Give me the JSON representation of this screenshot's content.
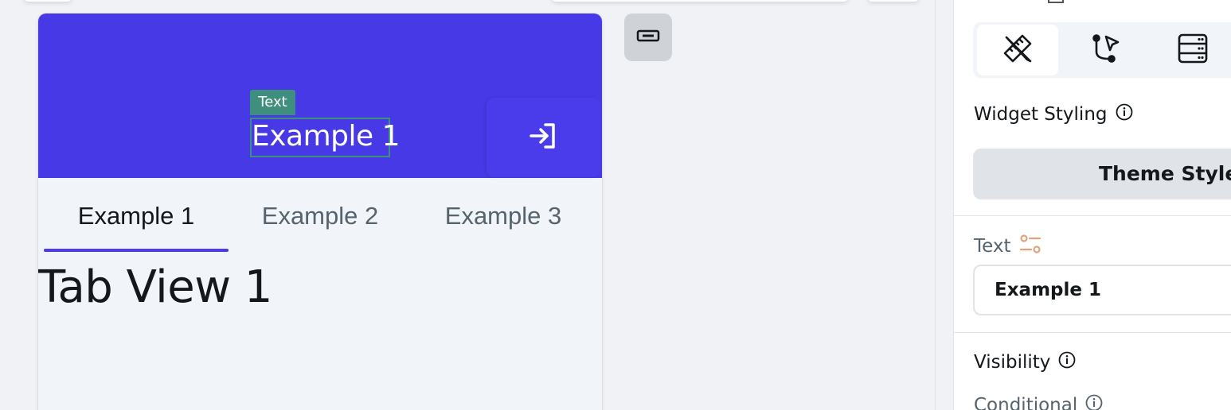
{
  "preview": {
    "selection_tag": "Text",
    "appbar_title": "Example 1",
    "tabs": [
      {
        "label": "Example 1",
        "active": true
      },
      {
        "label": "Example 2",
        "active": false
      },
      {
        "label": "Example 3",
        "active": false
      }
    ],
    "tab_content": "Tab View 1"
  },
  "panel": {
    "widget_styling_label": "Widget Styling",
    "theme_style_button": "Theme Style U",
    "text_label": "Text",
    "text_value": "Example 1",
    "visibility_label": "Visibility",
    "conditional_label": "Conditional"
  },
  "colors": {
    "appbar": "#4739e6",
    "accent": "#4b39ef",
    "selection": "#3f8f7e",
    "binding_icon": "#e0a37b"
  },
  "icons": {
    "login": "login-icon",
    "mini": "container-icon",
    "seg1": "ruler-pencil-icon",
    "seg2": "action-flow-icon",
    "seg3": "database-icon",
    "info": "info-icon",
    "binding": "variable-binding-icon"
  }
}
